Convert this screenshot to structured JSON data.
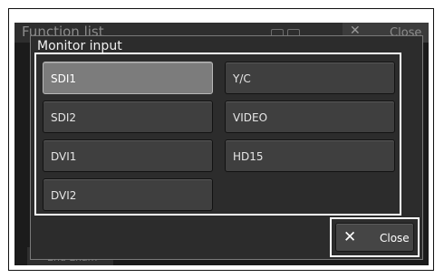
{
  "background": {
    "title": "Function list",
    "close_label": "Close",
    "close_icon": "close-icon",
    "end_exam_label": "End Exam"
  },
  "dialog": {
    "title": "Monitor input",
    "options": [
      {
        "label": "SDI1",
        "selected": true
      },
      {
        "label": "Y/C",
        "selected": false
      },
      {
        "label": "SDI2",
        "selected": false
      },
      {
        "label": "VIDEO",
        "selected": false
      },
      {
        "label": "DVI1",
        "selected": false
      },
      {
        "label": "HD15",
        "selected": false
      },
      {
        "label": "DVI2",
        "selected": false
      }
    ],
    "close_label": "Close",
    "close_icon": "close-icon"
  },
  "colors": {
    "screen_bg": "#1b1b1b",
    "dialog_bg": "#2c2c2c",
    "button_bg": "#3f3f3f",
    "selected_bg": "#7c7c7c",
    "highlight_border": "#ffffff"
  }
}
